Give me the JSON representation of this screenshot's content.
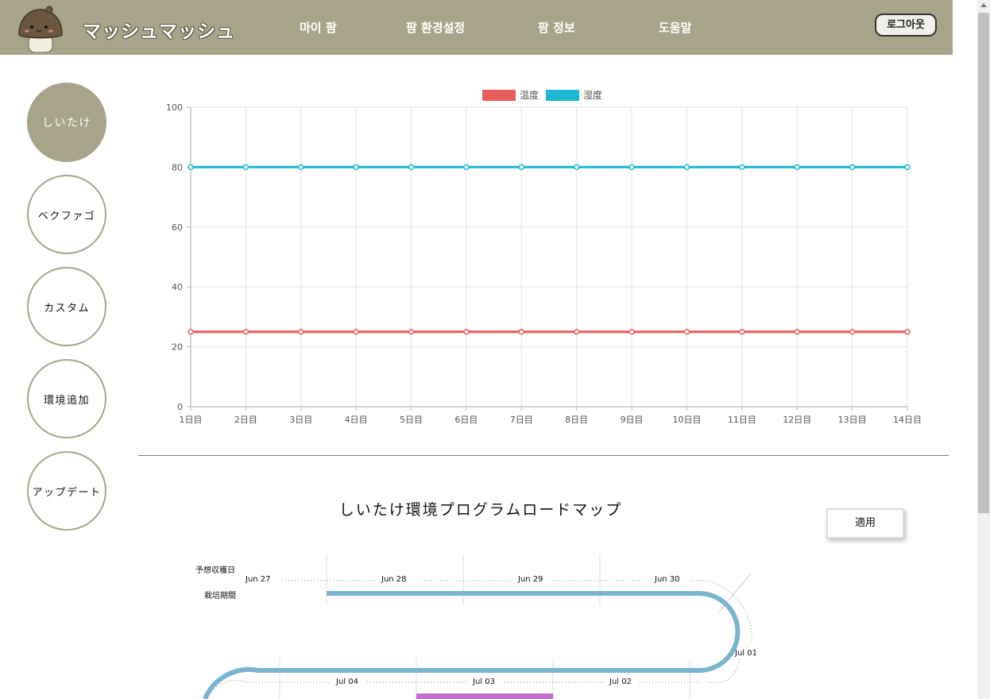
{
  "header": {
    "brand": "マッシュマッシュ",
    "nav": [
      "마이 팜",
      "팜 환경설정",
      "팜 정보",
      "도움말"
    ],
    "logout": "로그아웃",
    "bg_color": "#a8a48a"
  },
  "sidebar": {
    "items": [
      "しいたけ",
      "ベクファゴ",
      "カスタム",
      "環境追加",
      "アップデート"
    ],
    "active_index": 0
  },
  "chart_data": {
    "type": "line",
    "categories": [
      "1日目",
      "2日目",
      "3日目",
      "4日目",
      "5日目",
      "6日目",
      "7日目",
      "8日目",
      "9日目",
      "10日目",
      "11日目",
      "12日目",
      "13日目",
      "14日目"
    ],
    "series": [
      {
        "name": "温度",
        "color": "#e85c5c",
        "values": [
          25,
          25,
          25,
          25,
          25,
          25,
          25,
          25,
          25,
          25,
          25,
          25,
          25,
          25
        ]
      },
      {
        "name": "湿度",
        "color": "#1cb8d4",
        "values": [
          80,
          80,
          80,
          80,
          80,
          80,
          80,
          80,
          80,
          80,
          80,
          80,
          80,
          80
        ]
      }
    ],
    "ylim": [
      0,
      100
    ],
    "yticks": [
      0,
      20,
      40,
      60,
      80,
      100
    ],
    "grid": true,
    "legend": "top-center"
  },
  "roadmap": {
    "title": "しいたけ環境プログラムロードマップ",
    "apply_label": "適用",
    "row_labels": [
      "予想収穫日",
      "栽培期間"
    ],
    "dates_row1": [
      "Jun 27",
      "Jun 28",
      "Jun 29",
      "Jun 30"
    ],
    "date_turn": "Jul 01",
    "dates_row2": [
      "Jul 04",
      "Jul 03",
      "Jul 02"
    ],
    "track_color": "#7ab4d0",
    "bar_color": "#c070c8"
  }
}
